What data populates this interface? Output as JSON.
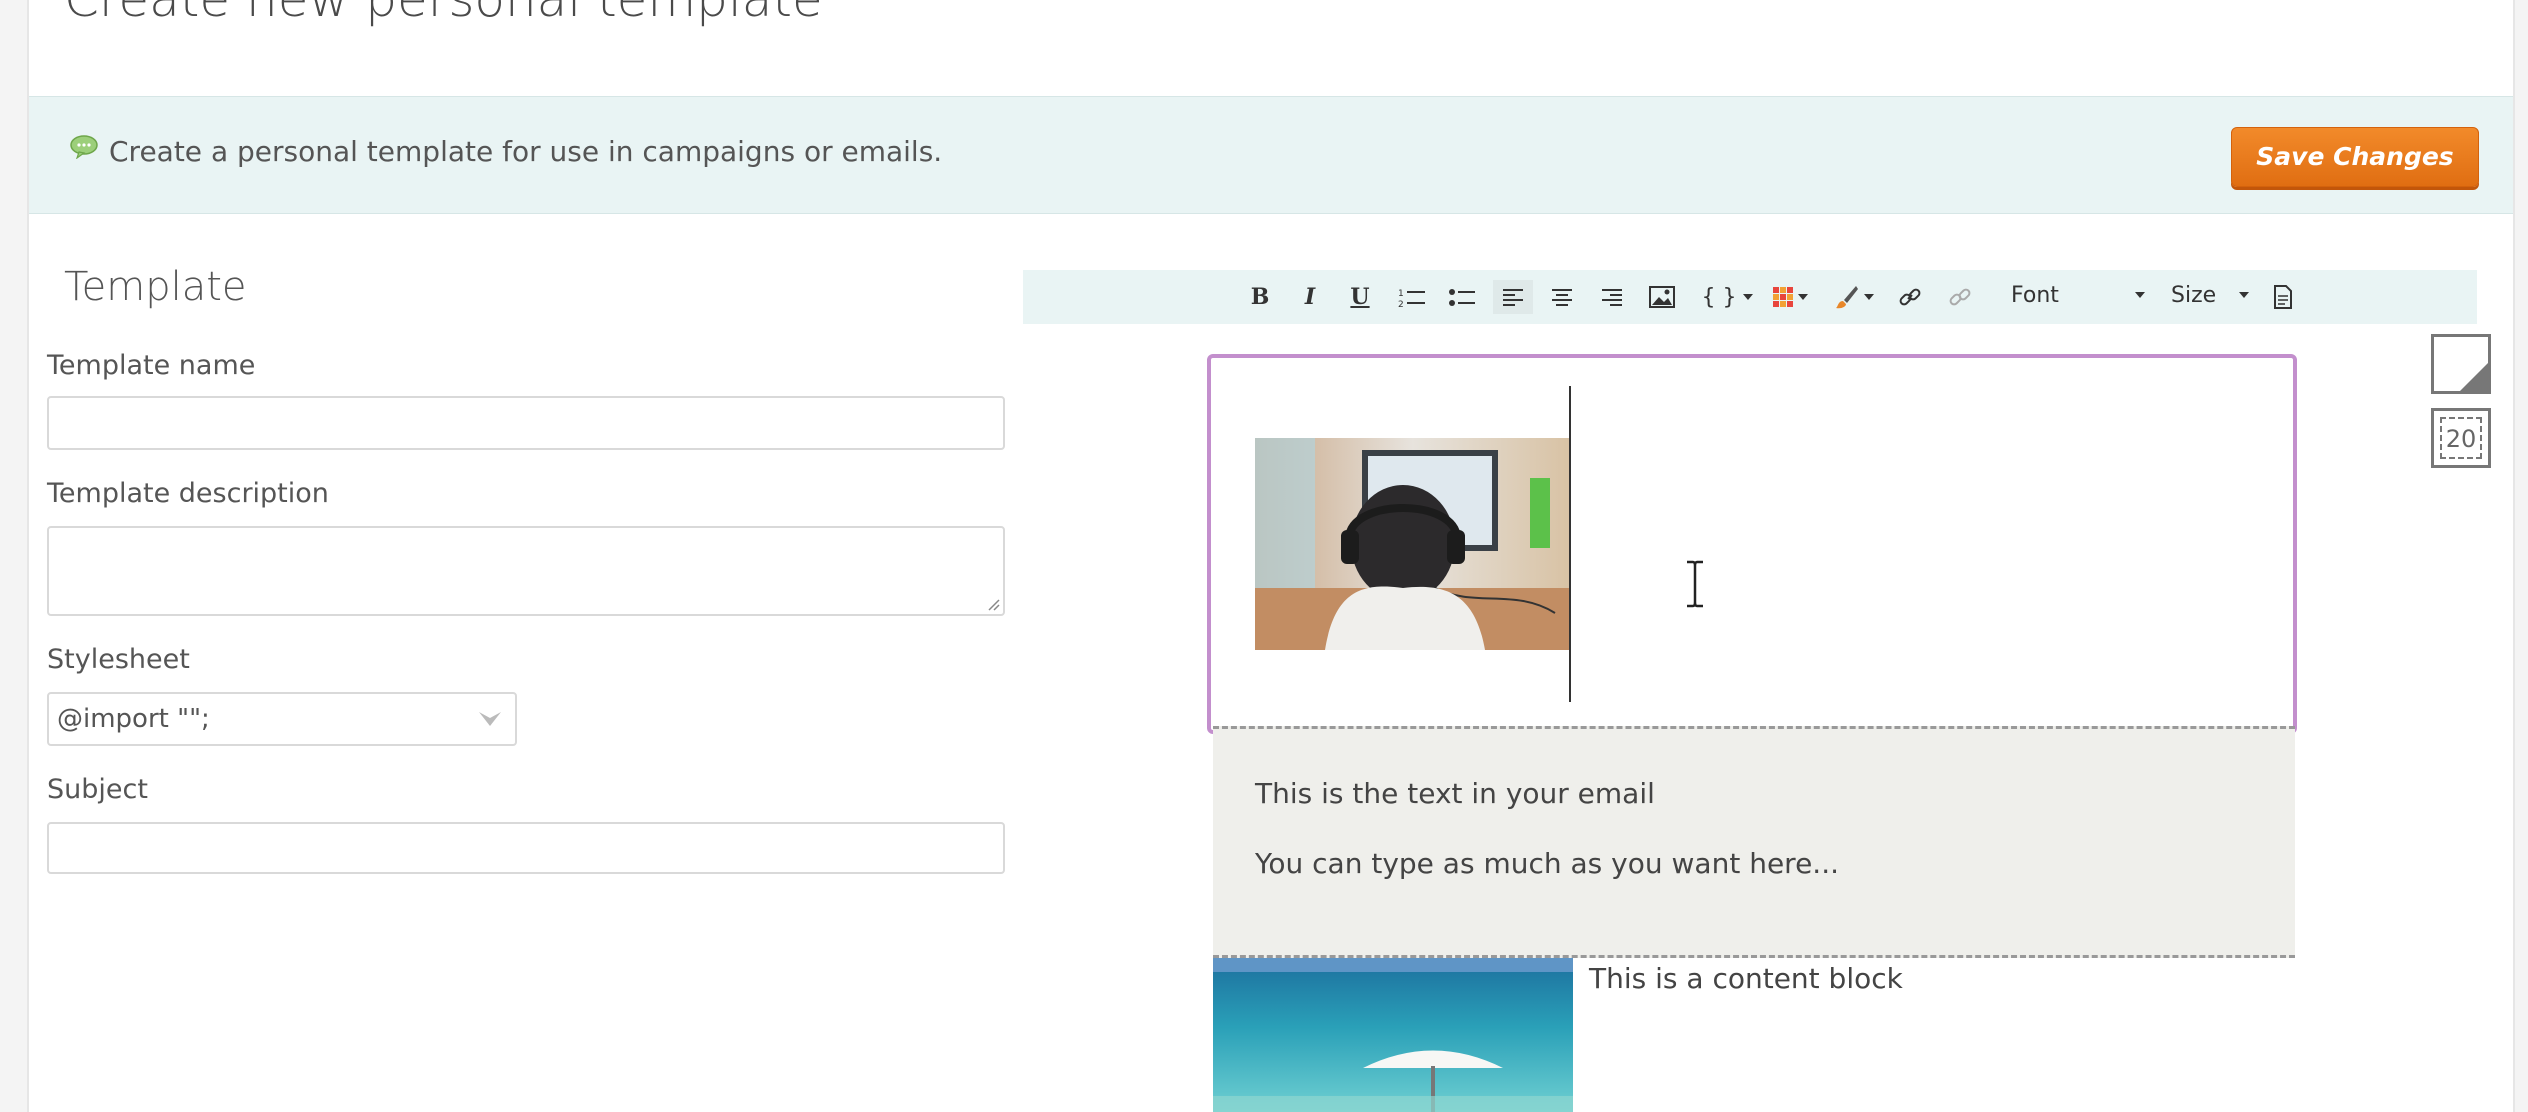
{
  "page": {
    "title": "Create new personal template"
  },
  "info_bar": {
    "message": "Create a personal template for use in campaigns or emails.",
    "save_label": "Save Changes"
  },
  "form": {
    "section_title": "Template",
    "name_label": "Template name",
    "name_value": "",
    "description_label": "Template description",
    "description_value": "",
    "stylesheet_label": "Stylesheet",
    "stylesheet_value": "@import \"\";",
    "subject_label": "Subject",
    "subject_value": ""
  },
  "toolbar": {
    "bold": "B",
    "italic": "I",
    "underline": "U",
    "font_label": "Font",
    "size_label": "Size",
    "merge_fields": "{ }",
    "icons": [
      "bold-icon",
      "italic-icon",
      "underline-icon",
      "ordered-list-icon",
      "unordered-list-icon",
      "align-left-icon",
      "align-center-icon",
      "align-right-icon",
      "image-icon",
      "merge-field-icon",
      "table-icon",
      "color-brush-icon",
      "link-icon",
      "unlink-icon",
      "source-icon"
    ]
  },
  "editor": {
    "text_line1": "This is the text in your email",
    "text_line2": "You can type as much as you want here...",
    "content_block_text": "This is a content block"
  },
  "side_panel": {
    "layout_count": "20"
  },
  "colors": {
    "accent_orange": "#e9781c",
    "info_bar_bg": "#e9f4f4",
    "editor_border": "#c38fcd",
    "text_block_bg": "#efefeb"
  }
}
